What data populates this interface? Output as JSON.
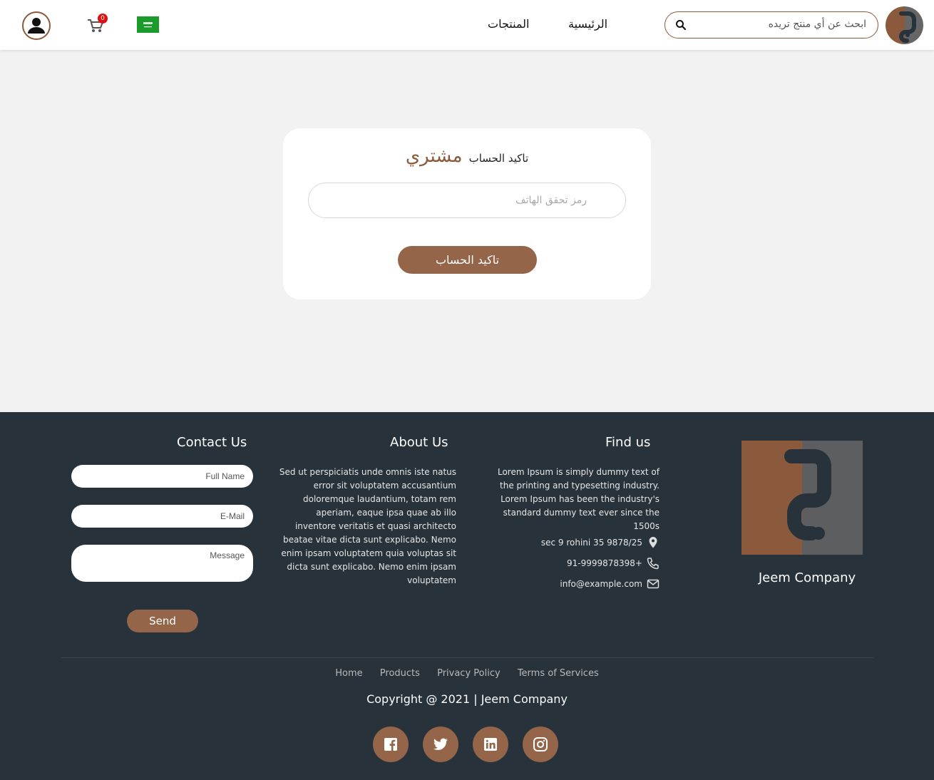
{
  "header": {
    "search_placeholder": "ابحث عن أي منتج تريده",
    "nav": {
      "home": "الرئيسية",
      "products": "المنتجات"
    },
    "cart_count": "0",
    "accent": "#8b5a3c"
  },
  "card": {
    "title_prefix": "تاكيد الحساب",
    "title_role": "مشتري",
    "otp_placeholder": "رمز تحقق الهاتف",
    "confirm_label": "تاكيد الحساب"
  },
  "footer": {
    "contact": {
      "heading": "Contact Us",
      "full_name_placeholder": "Full Name",
      "email_placeholder": "E-Mail",
      "message_placeholder": "Message",
      "send_label": "Send"
    },
    "about": {
      "heading": "About Us",
      "text": "Sed ut perspiciatis unde omnis iste natus error sit voluptatem accusantium doloremque laudantium, totam rem aperiam, eaque ipsa quae ab illo inventore veritatis et quasi architecto beatae vitae dicta sunt explicabo. Nemo enim ipsam voluptatem quia voluptas sit dicta sunt explicabo. Nemo enim ipsam voluptatem"
    },
    "find": {
      "heading": "Find us",
      "text": "Lorem Ipsum is simply dummy text of the printing and typesetting industry. Lorem Ipsum has been the industry's standard dummy text ever since the 1500s",
      "address": "sec 9 rohini 35 9878/25",
      "phone": "91-9999878398+",
      "email": "info@example.com"
    },
    "brand_name": "Jeem Company",
    "links": [
      "Home",
      "Products",
      "Privacy Policy",
      "Terms of Services"
    ],
    "copyright": "Copyright @ 2021 | Jeem Company",
    "socials": [
      "facebook-icon",
      "twitter-icon",
      "linkedin-icon",
      "instagram-icon"
    ],
    "bg_color": "#27323a",
    "button_color": "#946549"
  }
}
